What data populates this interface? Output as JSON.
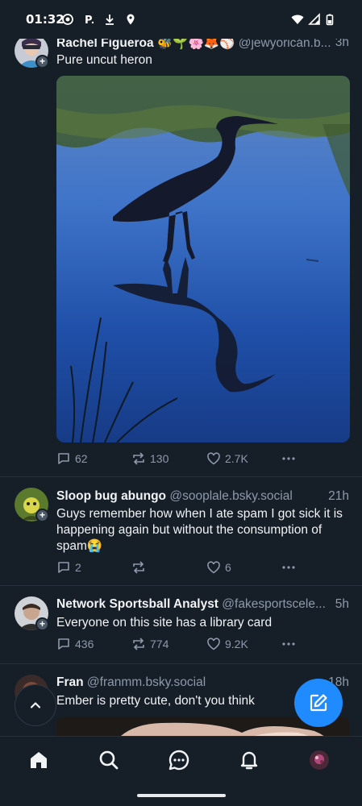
{
  "status_bar": {
    "time": "01:32"
  },
  "posts": [
    {
      "author_name": "Rachel Figueroa",
      "author_emoji": "🐝🌱🌸🦊⚾",
      "author_handle": "@jewyoricán.b...",
      "time": "3h",
      "text": "Pure uncut heron",
      "replies": "62",
      "reposts": "130",
      "likes": "2.7K"
    },
    {
      "author_name": "Sloop bug abungo",
      "author_handle": "@sooplale.bsky.social",
      "time": "21h",
      "text": "Guys remember how when I ate spam I got sick it is happening again but without the consumption of spam😭",
      "replies": "2",
      "reposts": "",
      "likes": "6"
    },
    {
      "author_name": "Network Sportsball Analyst",
      "author_handle": "@fakesportscele...",
      "time": "5h",
      "text": "Everyone on this site has a library card",
      "replies": "436",
      "reposts": "774",
      "likes": "9.2K"
    },
    {
      "author_name": "Fran",
      "author_handle": "@franmm.bsky.social",
      "time": "18h",
      "text": "Ember is pretty cute, don't you think"
    }
  ],
  "nav": [
    "home-icon",
    "search-icon",
    "chat-icon",
    "notifications-icon",
    "profile-avatar"
  ],
  "colors": {
    "background": "#161e27",
    "accent": "#208bfe",
    "muted": "#8c9aab"
  }
}
